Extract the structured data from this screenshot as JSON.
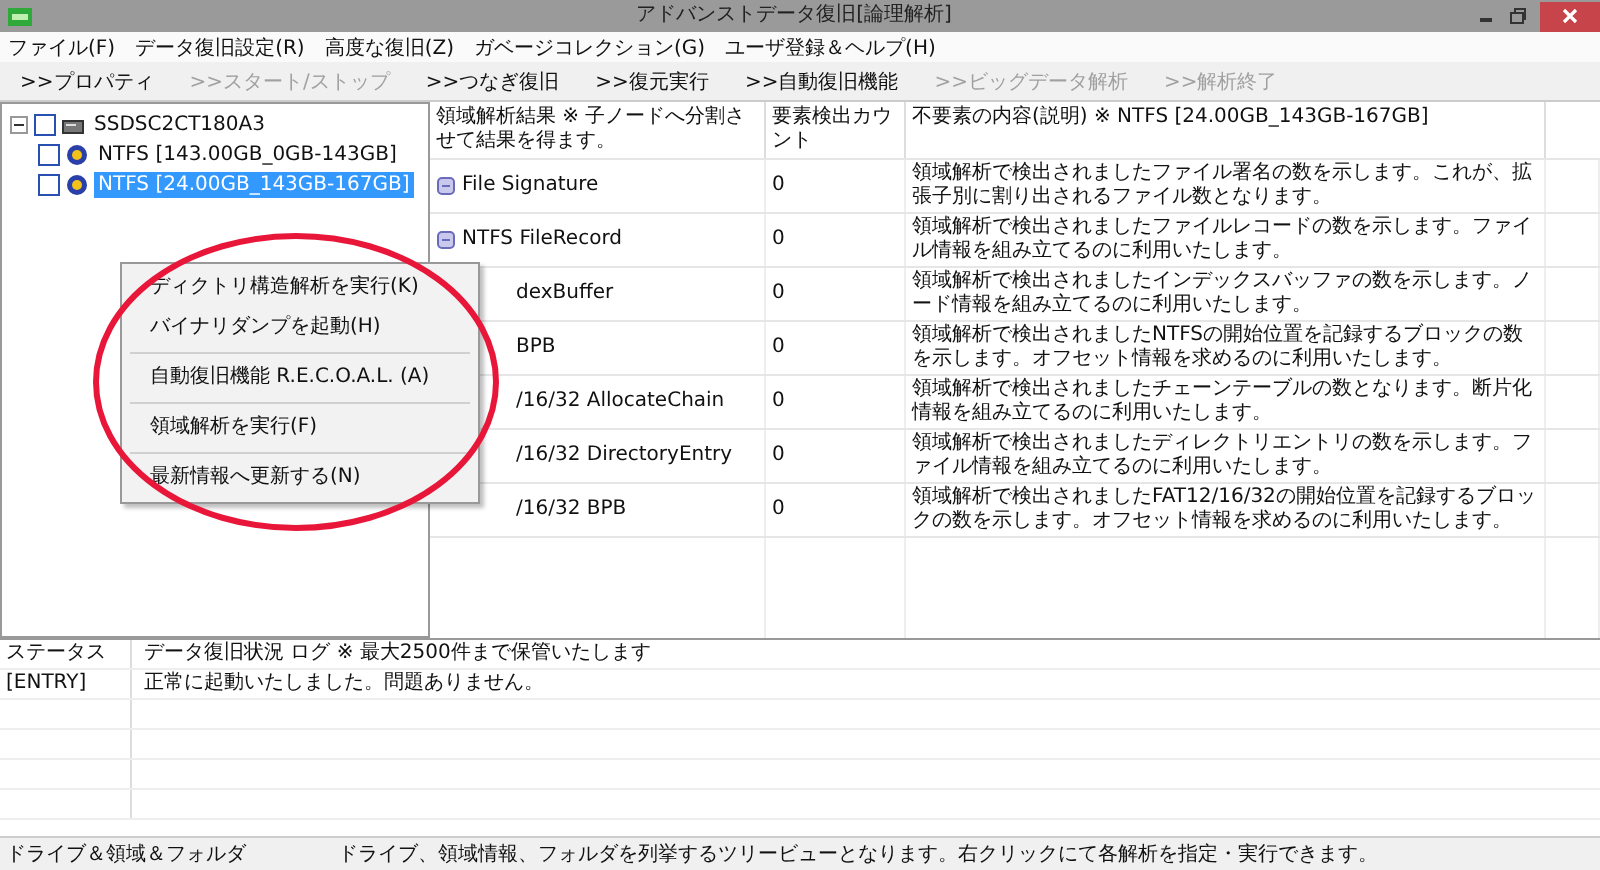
{
  "window": {
    "title": "アドバンストデータ復旧[論理解析]"
  },
  "menu": [
    "ファイル(F)",
    "データ復旧設定(R)",
    "高度な復旧(Z)",
    "ガベージコレクション(G)",
    "ユーザ登録＆ヘルプ(H)"
  ],
  "toolbar": [
    {
      "label": ">>プロパティ",
      "disabled": false
    },
    {
      "label": ">>スタート/ストップ",
      "disabled": true
    },
    {
      "label": ">>つなぎ復旧",
      "disabled": false
    },
    {
      "label": ">>復元実行",
      "disabled": false
    },
    {
      "label": ">>自動復旧機能",
      "disabled": false
    },
    {
      "label": ">>ビッグデータ解析",
      "disabled": true
    },
    {
      "label": ">>解析終了",
      "disabled": true
    }
  ],
  "tree": [
    {
      "label": "SSDSC2CT180A3",
      "checked": false,
      "expanded": true,
      "selected": false,
      "children": [
        {
          "label": "NTFS [143.00GB_0GB-143GB]",
          "checked": false,
          "selected": false
        },
        {
          "label": "NTFS [24.00GB_143GB-167GB]",
          "checked": false,
          "selected": true
        }
      ]
    }
  ],
  "context_menu": [
    {
      "kind": "item",
      "label": "ディクトリ構造解析を実行(K)"
    },
    {
      "kind": "item",
      "label": "バイナリダンプを起動(H)"
    },
    {
      "kind": "separator"
    },
    {
      "kind": "item",
      "label": "自動復旧機能 R.E.C.O.A.L. (A)"
    },
    {
      "kind": "separator"
    },
    {
      "kind": "item",
      "label": "領域解析を実行(F)"
    },
    {
      "kind": "separator"
    },
    {
      "kind": "item",
      "label": "最新情報へ更新する(N)"
    }
  ],
  "table": {
    "columns": [
      "領域解析結果 ※ 子ノードへ分割させて結果を得ます。",
      "要素検出カウント",
      "不要素の内容(説明) ※ NTFS [24.00GB_143GB-167GB]"
    ],
    "rows": [
      {
        "kind": "node",
        "name": "File Signature",
        "count": "0",
        "description": "領域解析で検出されましたファイル署名の数を示します。これが、拡張子別に割り出されるファイル数となります。"
      },
      {
        "kind": "node",
        "name": "NTFS FileRecord",
        "count": "0",
        "description": "領域解析で検出されましたファイルレコードの数を示します。ファイル情報を組み立てるのに利用いたします。"
      },
      {
        "kind": "partial",
        "name": "dexBuffer",
        "count": "0",
        "description": "領域解析で検出されましたインデックスバッファの数を示します。ノード情報を組み立てるのに利用いたします。"
      },
      {
        "kind": "partial",
        "name": "BPB",
        "count": "0",
        "description": "領域解析で検出されましたNTFSの開始位置を記録するブロックの数を示します。オフセット情報を求めるのに利用いたします。"
      },
      {
        "kind": "partial",
        "name": "/16/32 AllocateChain",
        "count": "0",
        "description": "領域解析で検出されましたチェーンテーブルの数となります。断片化情報を組み立てるのに利用いたします。"
      },
      {
        "kind": "partial",
        "name": "/16/32 DirectoryEntry",
        "count": "0",
        "description": "領域解析で検出されましたディレクトリエントリの数を示します。ファイル情報を組み立てるのに利用いたします。"
      },
      {
        "kind": "partial",
        "name": "/16/32 BPB",
        "count": "0",
        "description": "領域解析で検出されましたFAT12/16/32の開始位置を記録するブロックの数を示します。オフセット情報を求めるのに利用いたします。"
      }
    ]
  },
  "log": {
    "columns": [
      "ステータス",
      "データ復旧状況 ログ ※ 最大2500件まで保管いたします"
    ],
    "rows": [
      {
        "status": "[ENTRY]",
        "message": "正常に起動いたしました。問題ありません。"
      }
    ]
  },
  "status_bar": [
    "ドライブ＆領域＆フォルダ",
    "ドライブ、領域情報、フォルダを列挙するツリービューとなります。右クリックにて各解析を指定・実行できます。"
  ]
}
